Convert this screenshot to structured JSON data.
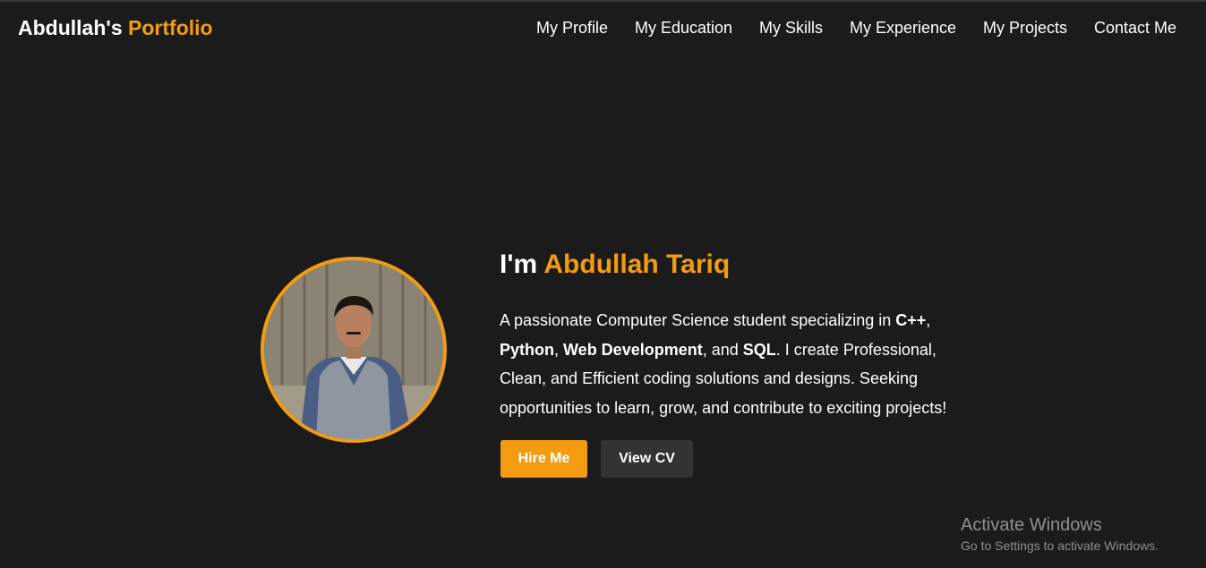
{
  "brand": {
    "name": "Abdullah's",
    "accent": "Portfolio"
  },
  "nav": {
    "items": [
      "My Profile",
      "My Education",
      "My Skills",
      "My Experience",
      "My Projects",
      "Contact Me"
    ]
  },
  "hero": {
    "greeting": "I'm",
    "name": "Abdullah Tariq",
    "description": {
      "t1": "A passionate Computer Science student specializing in ",
      "b1": "C++",
      "t2": ", ",
      "b2": "Python",
      "t3": ", ",
      "b3": "Web Development",
      "t4": ", and ",
      "b4": "SQL",
      "t5": ". I create Professional, Clean, and Efficient coding solutions and designs. Seeking opportunities to learn, grow, and contribute to exciting projects!"
    },
    "hire_label": "Hire Me",
    "cv_label": "View CV"
  },
  "watermark": {
    "title": "Activate Windows",
    "subtitle": "Go to Settings to activate Windows."
  },
  "colors": {
    "accent": "#f39c12",
    "background": "#1b1b1b",
    "secondary_button": "#333333"
  },
  "icons": {
    "avatar": "profile-photo"
  }
}
